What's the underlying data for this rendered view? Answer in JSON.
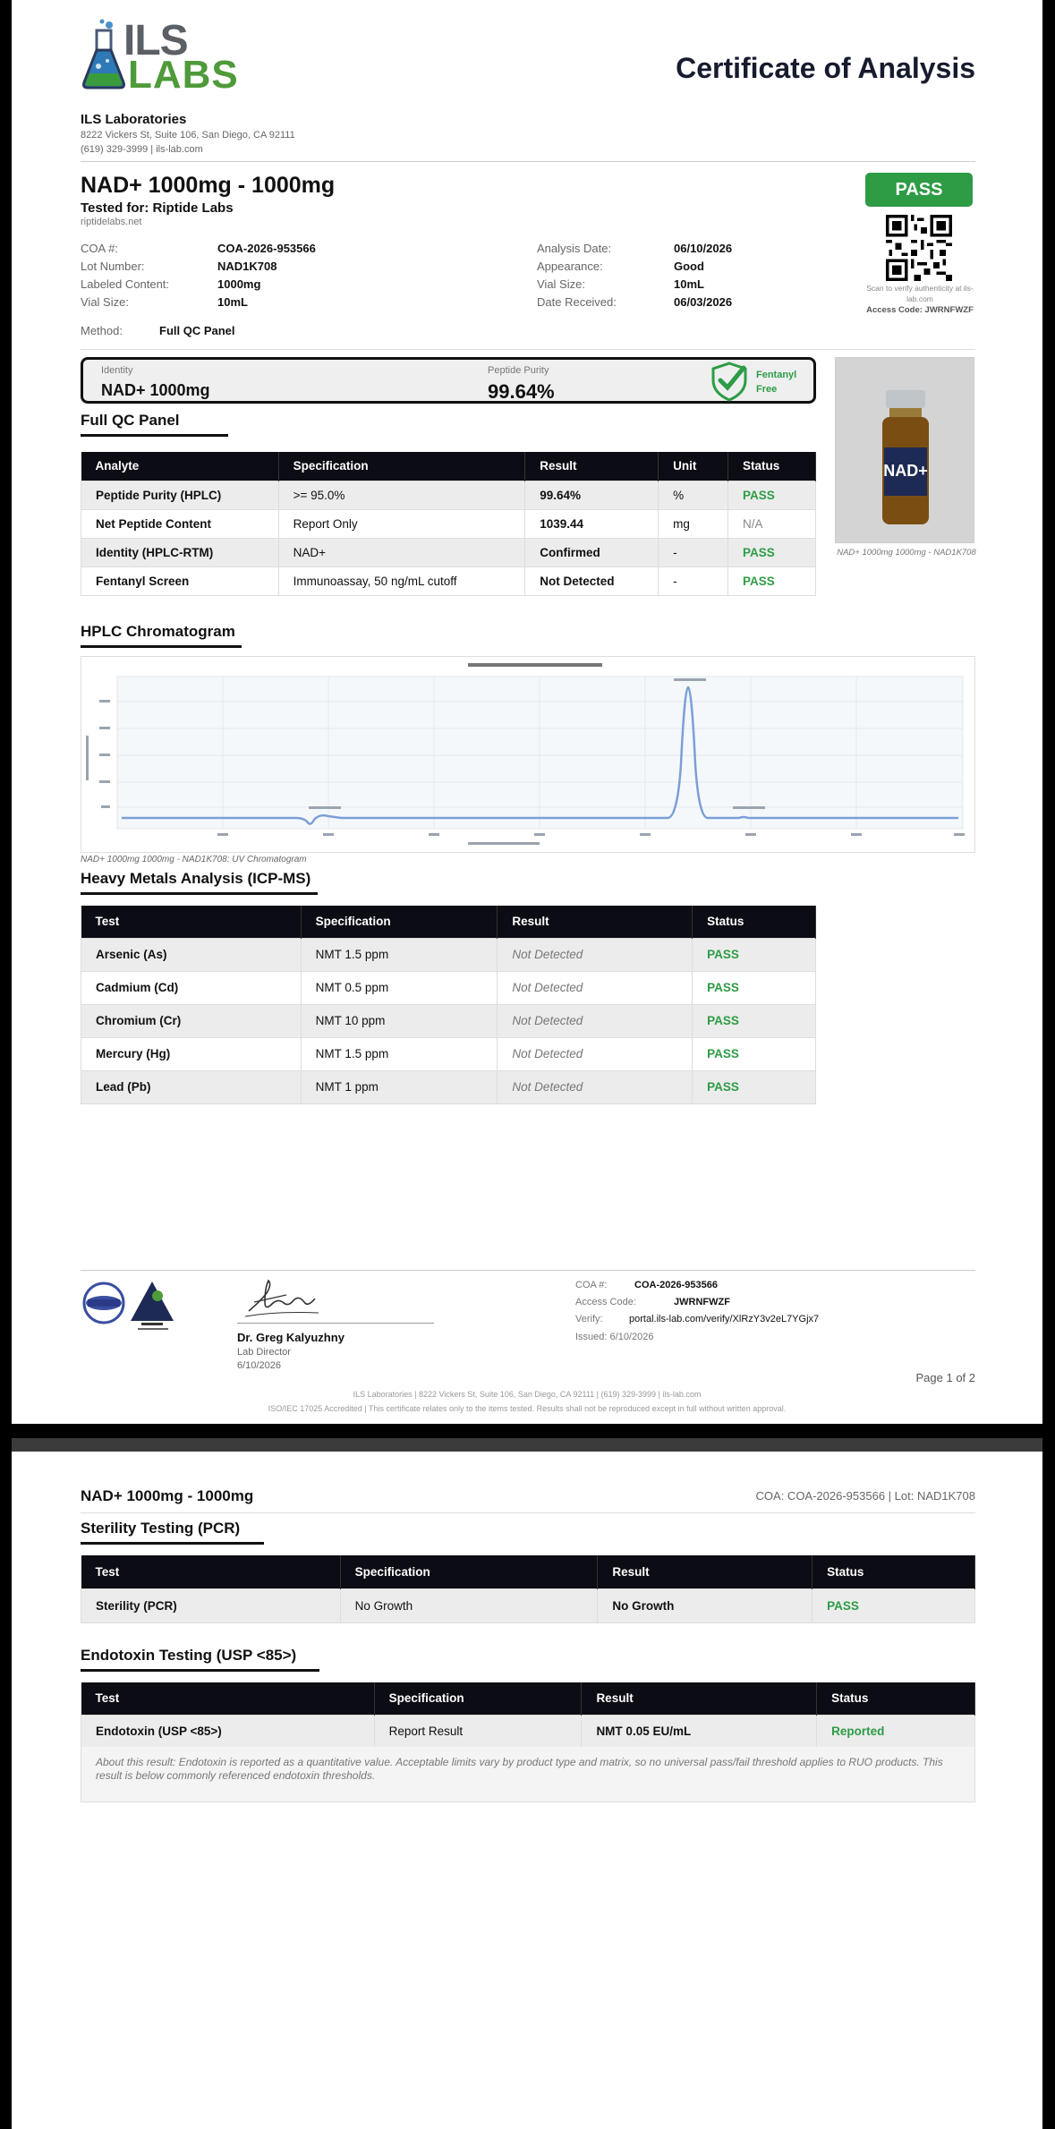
{
  "header": {
    "logo_top": "ILS",
    "logo_bottom": "LABS",
    "doc_title": "Certificate of Analysis",
    "lab_name": "ILS Laboratories",
    "lab_address": "8222 Vickers St, Suite 106, San Diego, CA 92111",
    "lab_contact": "(619) 329-3999  |  ils-lab.com"
  },
  "product": {
    "title": "NAD+ 1000mg - 1000mg",
    "tested_for": "Tested for: Riptide Labs",
    "client_site": "riptidelabs.net",
    "pass_label": "PASS",
    "scan_note": "Scan to verify authenticity at ils-lab.com",
    "access_note": "Access Code: JWRNFWZF"
  },
  "details_left": [
    {
      "label": "COA #:",
      "value": "COA-2026-953566"
    },
    {
      "label": "Lot Number:",
      "value": "NAD1K708"
    },
    {
      "label": "Labeled Content:",
      "value": "1000mg"
    },
    {
      "label": "Vial Size:",
      "value": "10mL"
    }
  ],
  "details_right": [
    {
      "label": "Analysis Date:",
      "value": "06/10/2026"
    },
    {
      "label": "Appearance:",
      "value": "Good"
    },
    {
      "label": "Vial Size:",
      "value": "10mL"
    },
    {
      "label": "Date Received:",
      "value": "06/03/2026"
    }
  ],
  "method": {
    "label": "Method:",
    "value": "Full QC Panel"
  },
  "summary": {
    "identity_label": "Identity",
    "identity_value": "NAD+ 1000mg",
    "purity_label": "Peptide Purity",
    "purity_value": "99.64%",
    "fentanyl_badge": "Fentanyl Free"
  },
  "photo": {
    "caption": "NAD+ 1000mg 1000mg - NAD1K708",
    "vial_label": "NAD+"
  },
  "qc_panel": {
    "title": "Full QC Panel",
    "headers": [
      "Analyte",
      "Specification",
      "Result",
      "Unit",
      "Status"
    ],
    "rows": [
      [
        "Peptide Purity (HPLC)",
        ">= 95.0%",
        "99.64%",
        "%",
        "PASS"
      ],
      [
        "Net Peptide Content",
        "Report Only",
        "1039.44",
        "mg",
        "N/A"
      ],
      [
        "Identity (HPLC-RTM)",
        "NAD+",
        "Confirmed",
        "-",
        "PASS"
      ],
      [
        "Fentanyl Screen",
        "Immunoassay, 50 ng/mL cutoff",
        "Not Detected",
        "-",
        "PASS"
      ]
    ]
  },
  "chromatogram": {
    "section_title": "HPLC Chromatogram",
    "caption": "NAD+ 1000mg 1000mg - NAD1K708: UV Chromatogram"
  },
  "heavy_metals": {
    "title": "Heavy Metals Analysis (ICP-MS)",
    "headers": [
      "Test",
      "Specification",
      "Result",
      "Status"
    ],
    "rows": [
      [
        "Arsenic (As)",
        "NMT 1.5 ppm",
        "Not Detected",
        "PASS"
      ],
      [
        "Cadmium (Cd)",
        "NMT 0.5 ppm",
        "Not Detected",
        "PASS"
      ],
      [
        "Chromium (Cr)",
        "NMT 10 ppm",
        "Not Detected",
        "PASS"
      ],
      [
        "Mercury (Hg)",
        "NMT 1.5 ppm",
        "Not Detected",
        "PASS"
      ],
      [
        "Lead (Pb)",
        "NMT 1 ppm",
        "Not Detected",
        "PASS"
      ]
    ]
  },
  "footer": {
    "signer_name": "Dr. Greg Kalyuzhny",
    "signer_role": "Lab Director",
    "signer_date": "6/10/2026",
    "coa_label": "COA #:",
    "coa_value": "COA-2026-953566",
    "access_label": "Access Code:",
    "access_value": "JWRNFWZF",
    "verify_label": "Verify:",
    "verify_value": "portal.ils-lab.com/verify/XlRzY3v2eL7YGjx7",
    "issued": "Issued: 6/10/2026",
    "page": "Page 1 of 2",
    "line1": "ILS Laboratories  |  8222 Vickers St, Suite 106, San Diego, CA 92111  |  (619) 329-3999  |  ils-lab.com",
    "line2": "ISO/IEC 17025 Accredited  |  This certificate relates only to the items tested. Results shall not be reproduced except in full without written approval."
  },
  "page2": {
    "title": "NAD+ 1000mg - 1000mg",
    "meta": "COA: COA-2026-953566  |  Lot: NAD1K708",
    "sterility": {
      "title": "Sterility Testing (PCR)",
      "headers": [
        "Test",
        "Specification",
        "Result",
        "Status"
      ],
      "row": [
        "Sterility (PCR)",
        "No Growth",
        "No Growth",
        "PASS"
      ]
    },
    "endotoxin": {
      "title": "Endotoxin Testing (USP <85>)",
      "headers": [
        "Test",
        "Specification",
        "Result",
        "Status"
      ],
      "row": [
        "Endotoxin (USP <85>)",
        "Report Result",
        "NMT 0.05 EU/mL",
        "Reported"
      ],
      "note": "About this result: Endotoxin is reported as a quantitative value. Acceptable limits vary by product type and matrix, so no universal pass/fail threshold applies to RUO products. This result is below commonly referenced endotoxin thresholds."
    }
  },
  "colors": {
    "pass": "#2d9c45",
    "header_bg": "#0c0c14",
    "title": "#161b2e"
  }
}
